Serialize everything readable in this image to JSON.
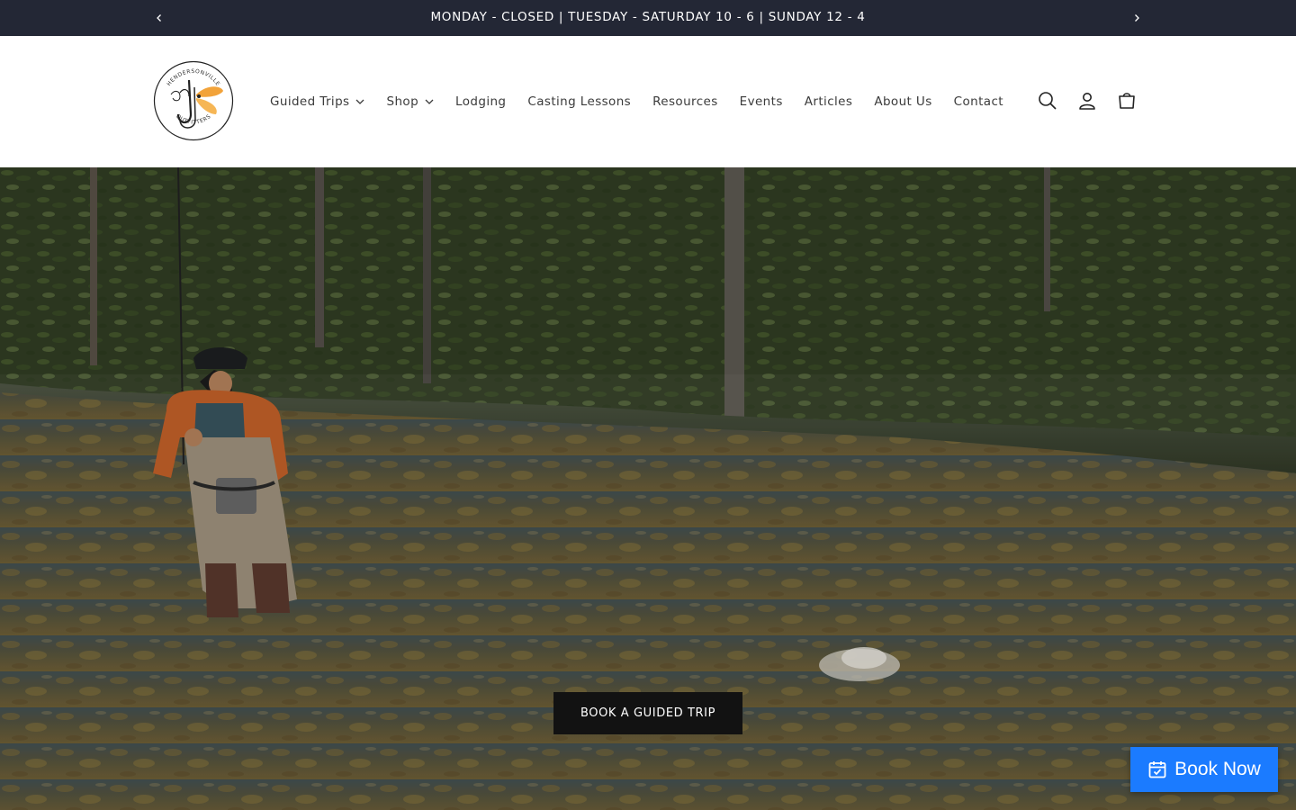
{
  "announcement": {
    "text": "MONDAY - CLOSED | TUESDAY - SATURDAY 10 - 6 | SUNDAY 12 - 4",
    "prev_icon": "chevron-left-icon",
    "next_icon": "chevron-right-icon"
  },
  "header": {
    "logo": {
      "top_text": "HENDERSONVILLE",
      "bottom_text": "OUTFITTERS",
      "icon": "fly-hook-logo"
    },
    "nav": [
      {
        "label": "Guided Trips",
        "has_dropdown": true
      },
      {
        "label": "Shop",
        "has_dropdown": true
      },
      {
        "label": "Lodging",
        "has_dropdown": false
      },
      {
        "label": "Casting Lessons",
        "has_dropdown": false
      },
      {
        "label": "Resources",
        "has_dropdown": false
      },
      {
        "label": "Events",
        "has_dropdown": false
      },
      {
        "label": "Articles",
        "has_dropdown": false
      },
      {
        "label": "About Us",
        "has_dropdown": false
      },
      {
        "label": "Contact",
        "has_dropdown": false
      }
    ],
    "icons": [
      "search-icon",
      "account-icon",
      "cart-icon"
    ]
  },
  "hero": {
    "image": "angler-wading-in-creek-photo",
    "button_label": "BOOK A GUIDED TRIP"
  },
  "floating": {
    "book_now_label": "Book Now",
    "icon": "calendar-check-icon"
  },
  "colors": {
    "announcement_bg": "#232735",
    "button_bg": "#121212",
    "book_now_bg": "#1b7bff",
    "logo_accent": "#f2a33a"
  }
}
